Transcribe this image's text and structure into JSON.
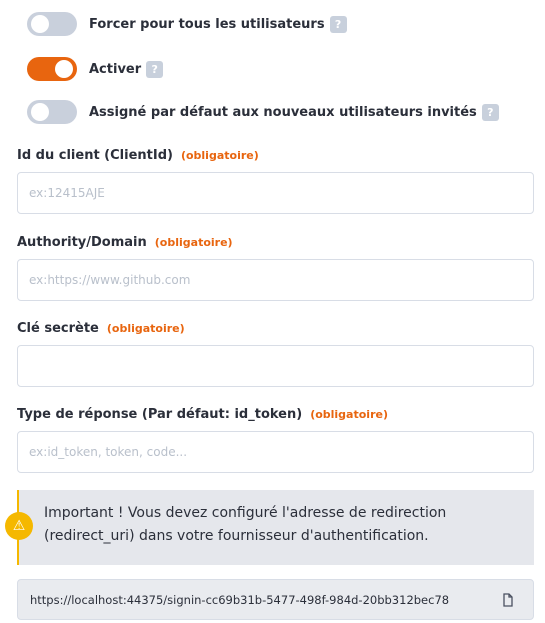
{
  "toggles": [
    {
      "label": "Forcer pour tous les utilisateurs",
      "on": false,
      "help": "?"
    },
    {
      "label": "Activer",
      "on": true,
      "help": "?"
    },
    {
      "label": "Assigné par défaut aux nouveaux utilisateurs invités",
      "on": false,
      "help": "?"
    }
  ],
  "required_text": "(obligatoire)",
  "fields": {
    "client_id": {
      "label": "Id du client (ClientId)",
      "placeholder": "ex:12415AJE",
      "value": ""
    },
    "authority": {
      "label": "Authority/Domain",
      "placeholder": "ex:https://www.github.com",
      "value": ""
    },
    "secret": {
      "label": "Clé secrète",
      "placeholder": "",
      "value": ""
    },
    "response_type": {
      "label": "Type de réponse (Par défaut: id_token)",
      "placeholder": "ex:id_token, token, code...",
      "value": ""
    }
  },
  "alert": {
    "text": "Important ! Vous devez configuré l'adresse de redirection (redirect_uri) dans votre fournisseur d'authentification.",
    "icon": "warning-icon"
  },
  "redirect_url": "https://localhost:44375/signin-cc69b31b-5477-498f-984d-20bb312bec78",
  "colors": {
    "accent": "#e8650f",
    "warning": "#f5b800",
    "toggle_off": "#c9d0dc"
  }
}
